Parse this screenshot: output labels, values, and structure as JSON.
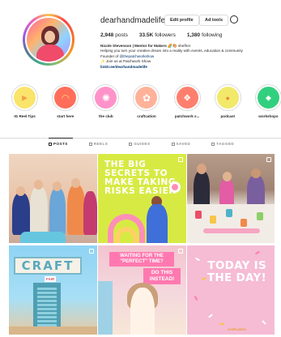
{
  "profile": {
    "username": "dearhandmadelife",
    "edit_label": "Edit profile",
    "ad_label": "Ad tools",
    "stats": {
      "posts": "2,948",
      "posts_label": "posts",
      "followers": "33.5K",
      "followers_label": "followers",
      "following": "1,380",
      "following_label": "following"
    },
    "bio": {
      "name": "Nicole Stevenson | Mentor for Makers",
      "name_suffix": "🌈🎨 shefher",
      "line1": "Helping you turn your creative dream into a reality with events, education & community",
      "line2_prefix": "Founder of ",
      "line2_tag": "@thepatchworkshow",
      "line3": "✨ Join us at Patchwork Show",
      "link": "linktr.ee/dearhandmadelife"
    }
  },
  "highlights": [
    {
      "label": "IG Reel Tips",
      "color": "#fbe46b",
      "glyph": "▶"
    },
    {
      "label": "start here",
      "color": "#ff6e5a",
      "glyph": "◠"
    },
    {
      "label": "the club",
      "color": "#ff93c9",
      "glyph": "✺"
    },
    {
      "label": "craftcation",
      "color": "#ffb29a",
      "glyph": "✿"
    },
    {
      "label": "patchwork s...",
      "color": "#ff7f6e",
      "glyph": "❖"
    },
    {
      "label": "podcast",
      "color": "#f2e86a",
      "glyph": "●"
    },
    {
      "label": "workshops",
      "color": "#32d07e",
      "glyph": "◆"
    }
  ],
  "tabs": [
    {
      "label": "POSTS",
      "active": true
    },
    {
      "label": "REELS",
      "active": false
    },
    {
      "label": "GUIDES",
      "active": false
    },
    {
      "label": "SAVED",
      "active": false
    },
    {
      "label": "TAGGED",
      "active": false
    }
  ],
  "posts": {
    "p2_text": "THE BIG SECRETS TO MAKE TAKING RISKS EASIER",
    "p4_sign": "CRAFT",
    "p4_sub": "FAIR",
    "p5_banner1": "WAITING FOR THE \"PERFECT\" TIME?",
    "p5_banner2": "DO THIS INSTEAD!",
    "p6_text": "TODAY IS THE DAY!",
    "p6_caption": "craftcation"
  },
  "colors": {
    "link": "#00376b",
    "verified": "#3897f0",
    "border": "#dbdbdb"
  }
}
